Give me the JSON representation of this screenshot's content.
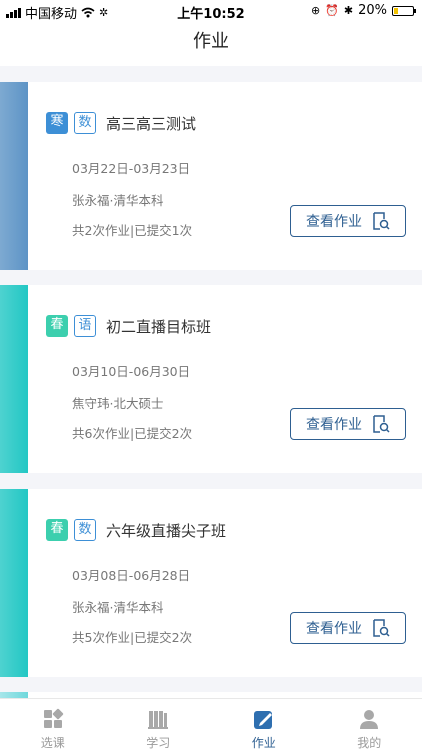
{
  "status_bar": {
    "carrier": "中国移动",
    "time": "上午10:52",
    "battery": "20%",
    "battery_level": 0.2
  },
  "nav": {
    "title": "作业"
  },
  "courses": [
    {
      "season_tag": "寒",
      "subject_tag": "数",
      "name": "高三高三测试",
      "date_range": "03月22日-03月23日",
      "teacher": "张永福·清华本科",
      "homework_stats": "共2次作业|已提交1次",
      "button_label": "查看作业",
      "stripe_color": "#5d94c6",
      "season_color": "#3d8fd6",
      "subject_color": "#3d8fd6"
    },
    {
      "season_tag": "春",
      "subject_tag": "语",
      "name": "初二直播目标班",
      "date_range": "03月10日-06月30日",
      "teacher": "焦守玮·北大硕士",
      "homework_stats": "共6次作业|已提交2次",
      "button_label": "查看作业",
      "stripe_color": "#22c7c4",
      "season_color": "#3ccfae",
      "subject_color": "#3d8fd6"
    },
    {
      "season_tag": "春",
      "subject_tag": "数",
      "name": "六年级直播尖子班",
      "date_range": "03月08日-06月28日",
      "teacher": "张永福·清华本科",
      "homework_stats": "共5次作业|已提交2次",
      "button_label": "查看作业",
      "stripe_color": "#22c7c4",
      "season_color": "#3ccfae",
      "subject_color": "#3d8fd6"
    }
  ],
  "tabs": [
    {
      "label": "选课",
      "icon": "grid-icon",
      "active": false
    },
    {
      "label": "学习",
      "icon": "books-icon",
      "active": false
    },
    {
      "label": "作业",
      "icon": "edit-icon",
      "active": true
    },
    {
      "label": "我的",
      "icon": "person-icon",
      "active": false
    }
  ],
  "colors": {
    "accent": "#2e5f91",
    "tab_active": "#2e5f91",
    "tab_inactive": "#9a9a9a"
  }
}
